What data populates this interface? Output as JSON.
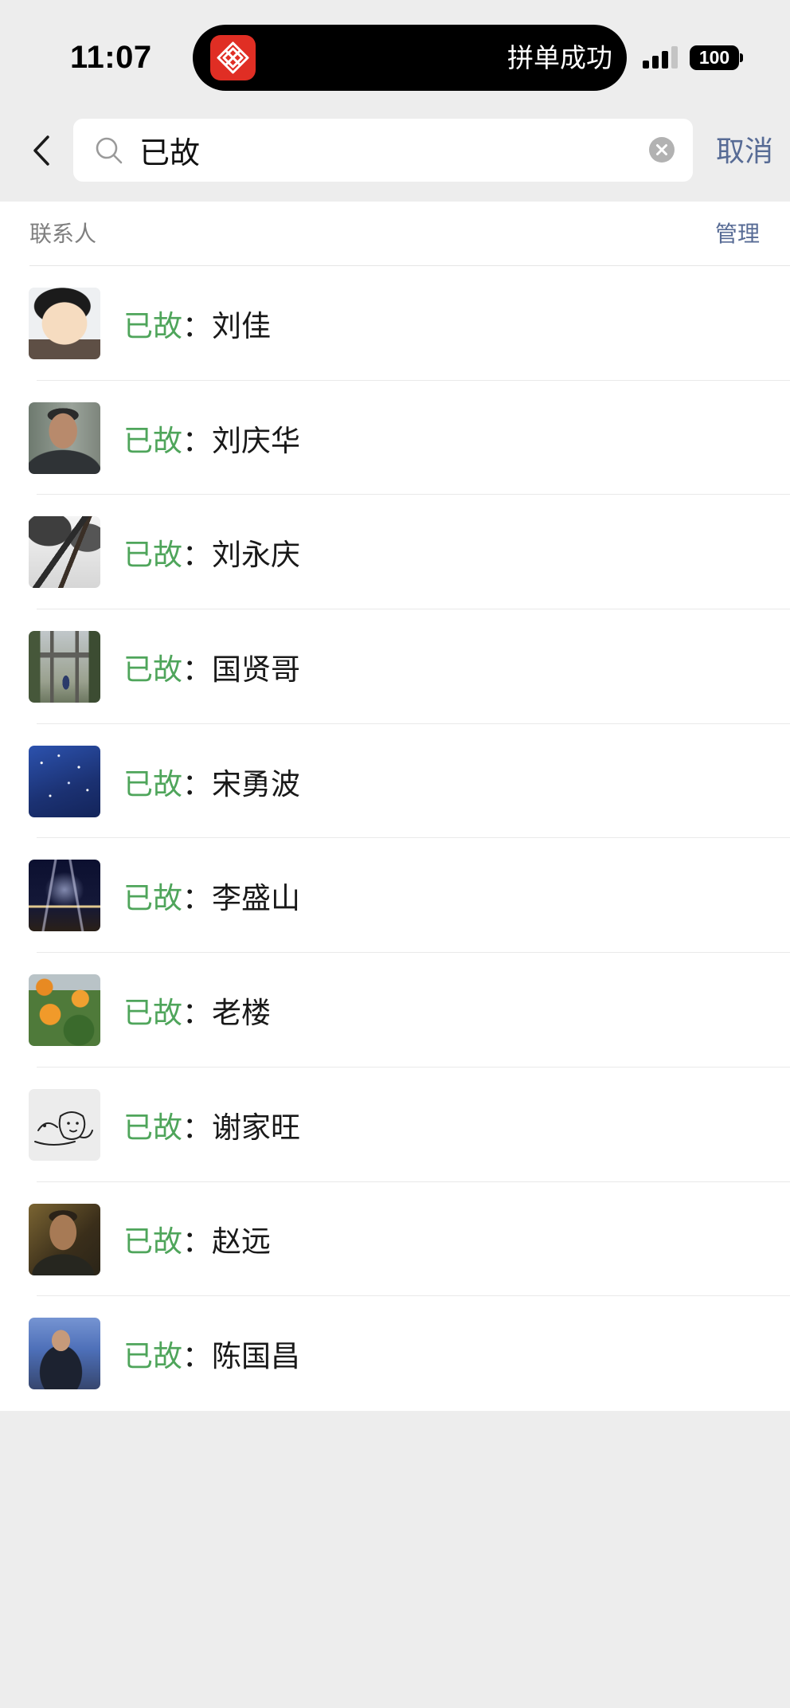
{
  "status_bar": {
    "time": "11:07",
    "notification": "拼单成功",
    "battery": "100",
    "app_icon": "pinduoduo-icon",
    "signal_icon": "cellular-signal-icon"
  },
  "search": {
    "query": "已故",
    "cancel_label": "取消",
    "back_icon": "chevron-left-icon",
    "search_icon": "search-icon",
    "clear_icon": "clear-icon"
  },
  "contacts": {
    "section_title": "联系人",
    "manage_label": "管理",
    "rows": [
      {
        "highlight": "已故",
        "separator": "：",
        "name": "刘佳"
      },
      {
        "highlight": "已故",
        "separator": "：",
        "name": "刘庆华"
      },
      {
        "highlight": "已故",
        "separator": "：",
        "name": "刘永庆"
      },
      {
        "highlight": "已故",
        "separator": "：",
        "name": "国贤哥"
      },
      {
        "highlight": "已故",
        "separator": "：",
        "name": "宋勇波"
      },
      {
        "highlight": "已故",
        "separator": "：",
        "name": "李盛山"
      },
      {
        "highlight": "已故",
        "separator": "：",
        "name": "老楼"
      },
      {
        "highlight": "已故",
        "separator": "：",
        "name": "谢家旺"
      },
      {
        "highlight": "已故",
        "separator": "：",
        "name": "赵远"
      },
      {
        "highlight": "已故",
        "separator": "：",
        "name": "陈国昌"
      }
    ]
  },
  "colors": {
    "background": "#ededed",
    "highlight": "#4fa55b",
    "link": "#576b95",
    "text": "#191919",
    "app_icon": "#e02e24"
  }
}
